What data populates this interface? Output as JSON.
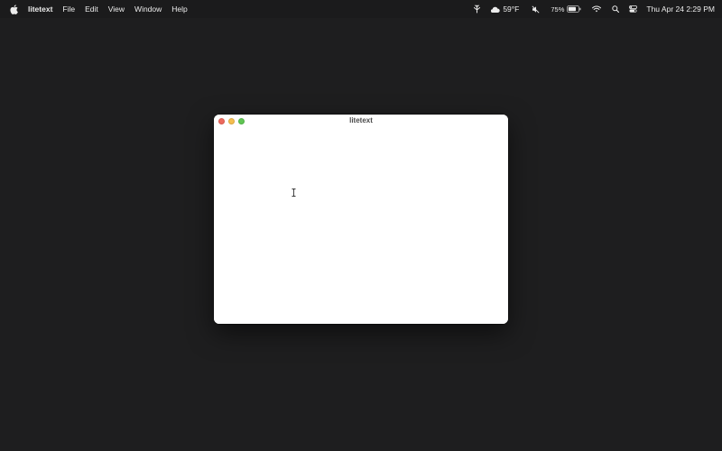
{
  "menubar": {
    "app_name": "litetext",
    "menus": [
      "File",
      "Edit",
      "View",
      "Window",
      "Help"
    ],
    "status": {
      "weather": "59°F",
      "battery": "75%",
      "clock": "Thu Apr 24  2:29 PM"
    },
    "icons": [
      "apple-icon",
      "dictation-icon",
      "cloud-icon",
      "mute-icon",
      "battery-icon",
      "wifi-icon",
      "search-icon",
      "control-center-icon"
    ]
  },
  "window": {
    "title": "litetext",
    "controls": [
      "close",
      "minimize",
      "zoom"
    ],
    "cursor": "i-beam"
  },
  "colors": {
    "desktop": "#1e1e1f",
    "menubar": "#1b1b1c",
    "close": "#ed6a5e",
    "minimize": "#f5bf4f",
    "zoom": "#61c554"
  }
}
